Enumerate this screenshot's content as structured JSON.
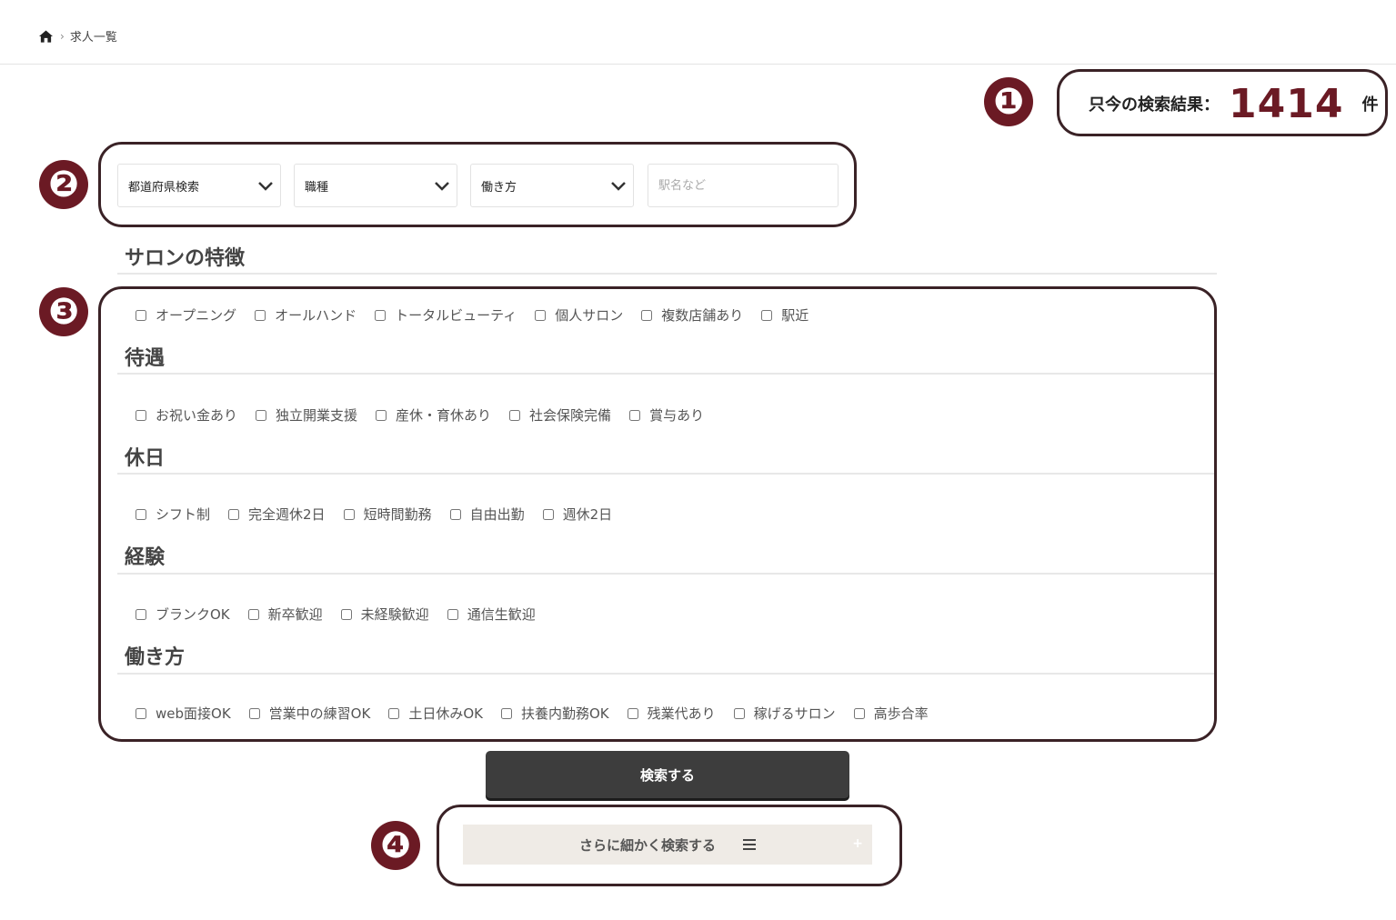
{
  "breadcrumb": {
    "home_icon": "home-icon",
    "separator": "›",
    "current": "求人一覧"
  },
  "markers": [
    "❶",
    "❷",
    "❸",
    "❹"
  ],
  "result": {
    "label": "只今の検索結果：",
    "count": "1414",
    "unit": "件"
  },
  "filters": {
    "prefecture": "都道府県検索",
    "job_type": "職種",
    "work_style": "働き方",
    "station_placeholder": "駅名など"
  },
  "sections": {
    "salon": {
      "title": "サロンの特徴",
      "options": [
        "オープニング",
        "オールハンド",
        "トータルビューティ",
        "個人サロン",
        "複数店舗あり",
        "駅近"
      ]
    },
    "benefits": {
      "title": "待遇",
      "options": [
        "お祝い金あり",
        "独立開業支援",
        "産休・育休あり",
        "社会保険完備",
        "賞与あり"
      ]
    },
    "holidays": {
      "title": "休日",
      "options": [
        "シフト制",
        "完全週休2日",
        "短時間勤務",
        "自由出勤",
        "週休2日"
      ]
    },
    "experience": {
      "title": "経験",
      "options": [
        "ブランクOK",
        "新卒歓迎",
        "未経験歓迎",
        "通信生歓迎"
      ]
    },
    "workstyle": {
      "title": "働き方",
      "options": [
        "web面接OK",
        "営業中の練習OK",
        "土日休みOK",
        "扶養内勤務OK",
        "残業代あり",
        "稼げるサロン",
        "高歩合率"
      ]
    }
  },
  "buttons": {
    "search": "検索する",
    "more": "さらに細かく検索する"
  },
  "colors": {
    "accent": "#6b1a24",
    "frame": "#3a2226",
    "button_dark": "#3d3d3d",
    "button_light": "#efebe6"
  }
}
